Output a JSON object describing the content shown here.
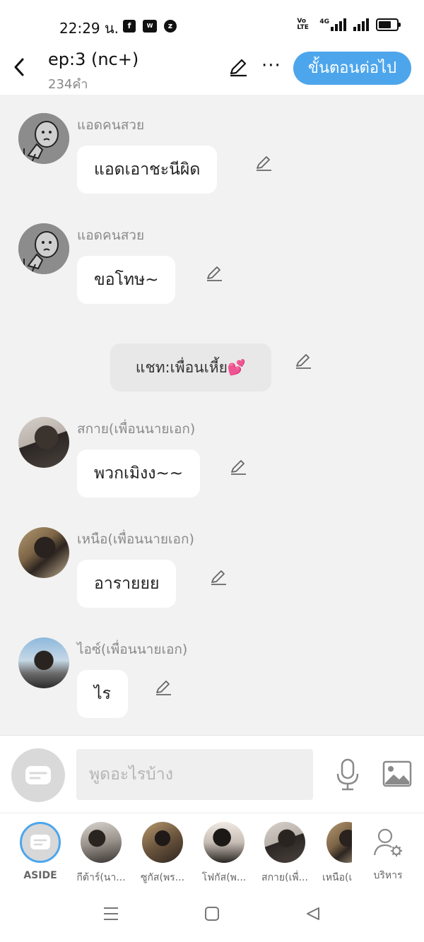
{
  "status_bar": {
    "time": "22:29 น.",
    "network": "4G",
    "volte": "Vo LTE"
  },
  "header": {
    "title": "ep:3 (nc+)",
    "word_count": "234คำ",
    "next_button": "ขั้นตอนต่อไป"
  },
  "messages": [
    {
      "sender": "แอดคนสวย",
      "text": "แอดเอาชะนีผิด"
    },
    {
      "sender": "แอดคนสวย",
      "text": "ขอโทษ~"
    },
    {
      "narration": "แชท:เพื่อนเหี้ย💕"
    },
    {
      "sender": "สกาย(เพื่อนนายเอก)",
      "text": "พวกเมิงง~~"
    },
    {
      "sender": "เหนือ(เพื่อนนายเอก)",
      "text": "อารายยย"
    },
    {
      "sender": "ไอซ์(เพื่อนนายเอก)",
      "text": "ไร"
    }
  ],
  "input": {
    "placeholder": "พูดอะไรบ้าง"
  },
  "characters": [
    {
      "name": "ASIDE"
    },
    {
      "name": "กีต้าร์(นา..."
    },
    {
      "name": "ซูกัส(พร..."
    },
    {
      "name": "โฟกัส(พ..."
    },
    {
      "name": "สกาย(เพื่..."
    },
    {
      "name": "เหนือ(เ"
    },
    {
      "name": "บริหาร"
    }
  ],
  "colors": {
    "accent": "#4da6ec",
    "background": "#f2f2f2",
    "bubble": "#ffffff",
    "narration_bubble": "#e8e8e8"
  }
}
